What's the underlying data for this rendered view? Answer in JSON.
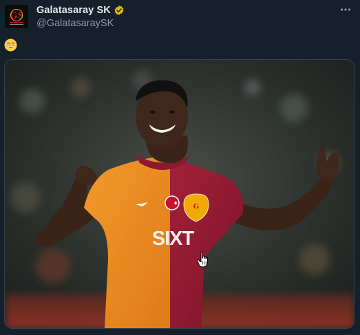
{
  "tweet": {
    "author": {
      "display_name": "Galatasaray SK",
      "handle": "@GalatasaraySK",
      "verified": true,
      "avatar_icon": "galatasaray-crest-icon"
    },
    "text_emoji": "😁",
    "media": {
      "type": "photo",
      "jersey_sponsor": "SIXT"
    },
    "more_icon": "more-horizontal-icon"
  },
  "colors": {
    "background": "#15202b",
    "text_primary": "#e7e9ea",
    "text_secondary": "#8b98a5",
    "verified_badge": "#e2b719",
    "border": "#38444d"
  }
}
